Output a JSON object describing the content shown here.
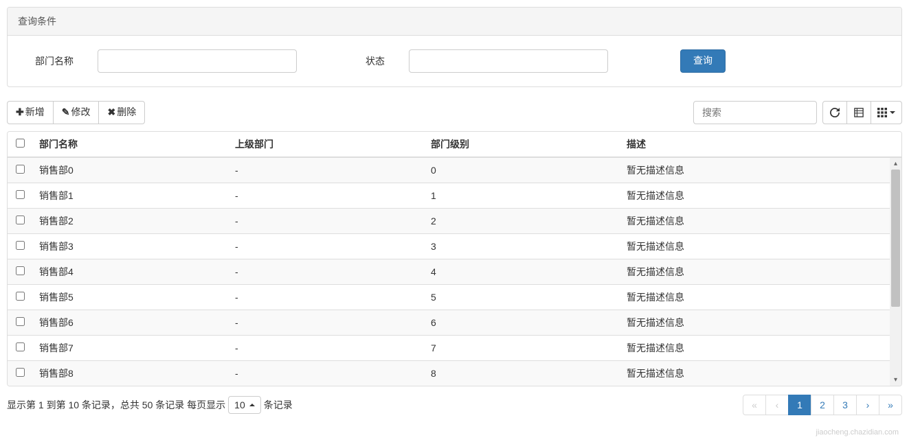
{
  "query_panel": {
    "title": "查询条件",
    "dept_name_label": "部门名称",
    "status_label": "状态",
    "search_button": "查询"
  },
  "toolbar": {
    "add_label": "新增",
    "edit_label": "修改",
    "delete_label": "删除",
    "search_placeholder": "搜索"
  },
  "table": {
    "headers": {
      "dept_name": "部门名称",
      "parent_dept": "上级部门",
      "dept_level": "部门级别",
      "description": "描述"
    },
    "rows": [
      {
        "dept_name": "销售部0",
        "parent_dept": "-",
        "dept_level": "0",
        "description": "暂无描述信息"
      },
      {
        "dept_name": "销售部1",
        "parent_dept": "-",
        "dept_level": "1",
        "description": "暂无描述信息"
      },
      {
        "dept_name": "销售部2",
        "parent_dept": "-",
        "dept_level": "2",
        "description": "暂无描述信息"
      },
      {
        "dept_name": "销售部3",
        "parent_dept": "-",
        "dept_level": "3",
        "description": "暂无描述信息"
      },
      {
        "dept_name": "销售部4",
        "parent_dept": "-",
        "dept_level": "4",
        "description": "暂无描述信息"
      },
      {
        "dept_name": "销售部5",
        "parent_dept": "-",
        "dept_level": "5",
        "description": "暂无描述信息"
      },
      {
        "dept_name": "销售部6",
        "parent_dept": "-",
        "dept_level": "6",
        "description": "暂无描述信息"
      },
      {
        "dept_name": "销售部7",
        "parent_dept": "-",
        "dept_level": "7",
        "description": "暂无描述信息"
      },
      {
        "dept_name": "销售部8",
        "parent_dept": "-",
        "dept_level": "8",
        "description": "暂无描述信息"
      }
    ]
  },
  "pagination": {
    "info_prefix": "显示第 1 到第 10 条记录，总共 50 条记录 每页显示",
    "info_suffix": "条记录",
    "page_size": "10",
    "first": "«",
    "prev": "‹",
    "pages": [
      "1",
      "2",
      "3"
    ],
    "active_page": "1",
    "next": "›",
    "last": "»"
  },
  "watermark": "jiaocheng.chazidian.com"
}
